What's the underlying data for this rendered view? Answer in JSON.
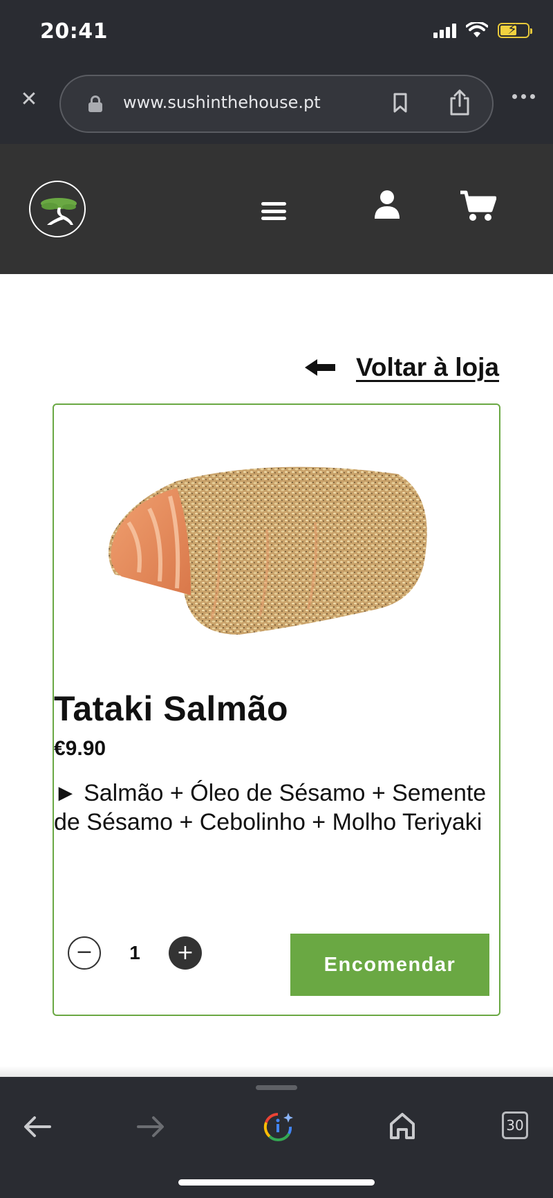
{
  "status_bar": {
    "time": "20:41"
  },
  "browser": {
    "url": "www.sushinthehouse.pt",
    "tab_count": "30"
  },
  "site": {
    "back_link_label": "Voltar à loja"
  },
  "product": {
    "name": "Tataki Salmão",
    "price": "€9.90",
    "description": "► Salmão + Óleo de Sésamo + Semente de Sésamo + Cebolinho + Molho Teriyaki",
    "quantity": "1",
    "order_button_label": "Encomendar"
  },
  "colors": {
    "accent_green": "#6aa843",
    "header_bg": "#333333",
    "browser_chrome": "#2a2c32"
  },
  "icons": [
    "close-icon",
    "lock-icon",
    "bookmark-icon",
    "share-icon",
    "more-icon",
    "logo-bonsai-icon",
    "menu-icon",
    "user-icon",
    "cart-icon",
    "arrow-left-icon",
    "minus-icon",
    "plus-icon",
    "back-icon",
    "forward-icon",
    "assistant-icon",
    "home-icon"
  ]
}
